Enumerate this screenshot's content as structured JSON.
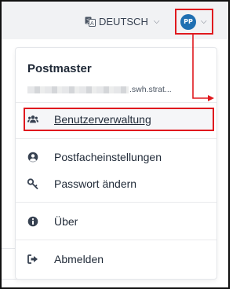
{
  "header": {
    "language": "DEUTSCH",
    "user_initials": "PP"
  },
  "user_menu": {
    "name": "Postmaster",
    "email_suffix": ".swh.strat...",
    "items": [
      {
        "label": "Benutzerverwaltung",
        "icon": "users-icon"
      },
      {
        "label": "Postfacheinstellungen",
        "icon": "user-circle-icon"
      },
      {
        "label": "Passwort ändern",
        "icon": "key-icon"
      },
      {
        "label": "Über",
        "icon": "info-icon"
      },
      {
        "label": "Abmelden",
        "icon": "sign-out-icon"
      }
    ]
  },
  "colors": {
    "accent_red": "#e0191e",
    "avatar_blue": "#1f6fb2"
  }
}
